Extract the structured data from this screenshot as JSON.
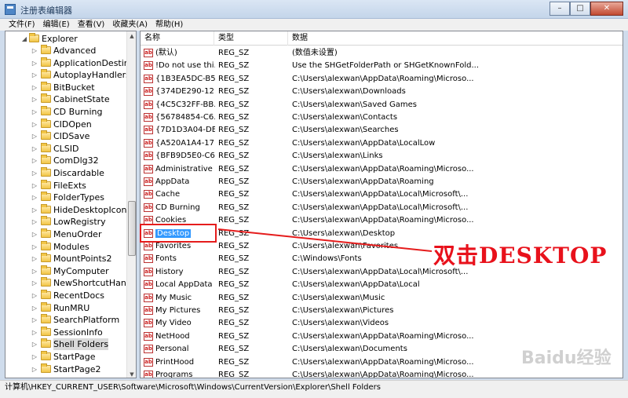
{
  "window": {
    "title": "注册表编辑器",
    "buttons": {
      "minimize": "–",
      "maximize": "□",
      "close": "✕"
    }
  },
  "menubar": [
    "文件(F)",
    "编辑(E)",
    "查看(V)",
    "收藏夹(A)",
    "帮助(H)"
  ],
  "tree": {
    "root": "Explorer",
    "items": [
      "Advanced",
      "ApplicationDestinati",
      "AutoplayHandlers",
      "BitBucket",
      "CabinetState",
      "CD Burning",
      "CIDOpen",
      "CIDSave",
      "CLSID",
      "ComDlg32",
      "Discardable",
      "FileExts",
      "FolderTypes",
      "HideDesktopIcons",
      "LowRegistry",
      "MenuOrder",
      "Modules",
      "MountPoints2",
      "MyComputer",
      "NewShortcutHandler",
      "RecentDocs",
      "RunMRU",
      "SearchPlatform",
      "SessionInfo",
      "Shell Folders",
      "StartPage",
      "StartPage2"
    ],
    "selected": "Shell Folders"
  },
  "list": {
    "headers": [
      "名称",
      "类型",
      "数据"
    ],
    "rows": [
      {
        "name": "(默认)",
        "type": "REG_SZ",
        "data": "(数值未设置)"
      },
      {
        "name": "!Do not use thi...",
        "type": "REG_SZ",
        "data": "Use the SHGetFolderPath or SHGetKnownFold..."
      },
      {
        "name": "{1B3EA5DC-B5...",
        "type": "REG_SZ",
        "data": "C:\\Users\\alexwan\\AppData\\Roaming\\Microso..."
      },
      {
        "name": "{374DE290-12...",
        "type": "REG_SZ",
        "data": "C:\\Users\\alexwan\\Downloads"
      },
      {
        "name": "{4C5C32FF-BB...",
        "type": "REG_SZ",
        "data": "C:\\Users\\alexwan\\Saved Games"
      },
      {
        "name": "{56784854-C6...",
        "type": "REG_SZ",
        "data": "C:\\Users\\alexwan\\Contacts"
      },
      {
        "name": "{7D1D3A04-DE...",
        "type": "REG_SZ",
        "data": "C:\\Users\\alexwan\\Searches"
      },
      {
        "name": "{A520A1A4-17...",
        "type": "REG_SZ",
        "data": "C:\\Users\\alexwan\\AppData\\LocalLow"
      },
      {
        "name": "{BFB9D5E0-C6...",
        "type": "REG_SZ",
        "data": "C:\\Users\\alexwan\\Links"
      },
      {
        "name": "Administrative ...",
        "type": "REG_SZ",
        "data": "C:\\Users\\alexwan\\AppData\\Roaming\\Microso..."
      },
      {
        "name": "AppData",
        "type": "REG_SZ",
        "data": "C:\\Users\\alexwan\\AppData\\Roaming"
      },
      {
        "name": "Cache",
        "type": "REG_SZ",
        "data": "C:\\Users\\alexwan\\AppData\\Local\\Microsoft\\..."
      },
      {
        "name": "CD Burning",
        "type": "REG_SZ",
        "data": "C:\\Users\\alexwan\\AppData\\Local\\Microsoft\\..."
      },
      {
        "name": "Cookies",
        "type": "REG_SZ",
        "data": "C:\\Users\\alexwan\\AppData\\Roaming\\Microso..."
      },
      {
        "name": "Desktop",
        "type": "REG_SZ",
        "data": "C:\\Users\\alexwan\\Desktop"
      },
      {
        "name": "Favorites",
        "type": "REG_SZ",
        "data": "C:\\Users\\alexwan\\Favorites"
      },
      {
        "name": "Fonts",
        "type": "REG_SZ",
        "data": "C:\\Windows\\Fonts"
      },
      {
        "name": "History",
        "type": "REG_SZ",
        "data": "C:\\Users\\alexwan\\AppData\\Local\\Microsoft\\..."
      },
      {
        "name": "Local AppData",
        "type": "REG_SZ",
        "data": "C:\\Users\\alexwan\\AppData\\Local"
      },
      {
        "name": "My Music",
        "type": "REG_SZ",
        "data": "C:\\Users\\alexwan\\Music"
      },
      {
        "name": "My Pictures",
        "type": "REG_SZ",
        "data": "C:\\Users\\alexwan\\Pictures"
      },
      {
        "name": "My Video",
        "type": "REG_SZ",
        "data": "C:\\Users\\alexwan\\Videos"
      },
      {
        "name": "NetHood",
        "type": "REG_SZ",
        "data": "C:\\Users\\alexwan\\AppData\\Roaming\\Microso..."
      },
      {
        "name": "Personal",
        "type": "REG_SZ",
        "data": "C:\\Users\\alexwan\\Documents"
      },
      {
        "name": "PrintHood",
        "type": "REG_SZ",
        "data": "C:\\Users\\alexwan\\AppData\\Roaming\\Microso..."
      },
      {
        "name": "Programs",
        "type": "REG_SZ",
        "data": "C:\\Users\\alexwan\\AppData\\Roaming\\Microso..."
      }
    ],
    "selected": "Desktop"
  },
  "annotation": {
    "text": "双击DESKTOP",
    "color": "#e8111b"
  },
  "statusbar": {
    "path": "计算机\\HKEY_CURRENT_USER\\Software\\Microsoft\\Windows\\CurrentVersion\\Explorer\\Shell Folders"
  },
  "watermark": "Baidu经验"
}
